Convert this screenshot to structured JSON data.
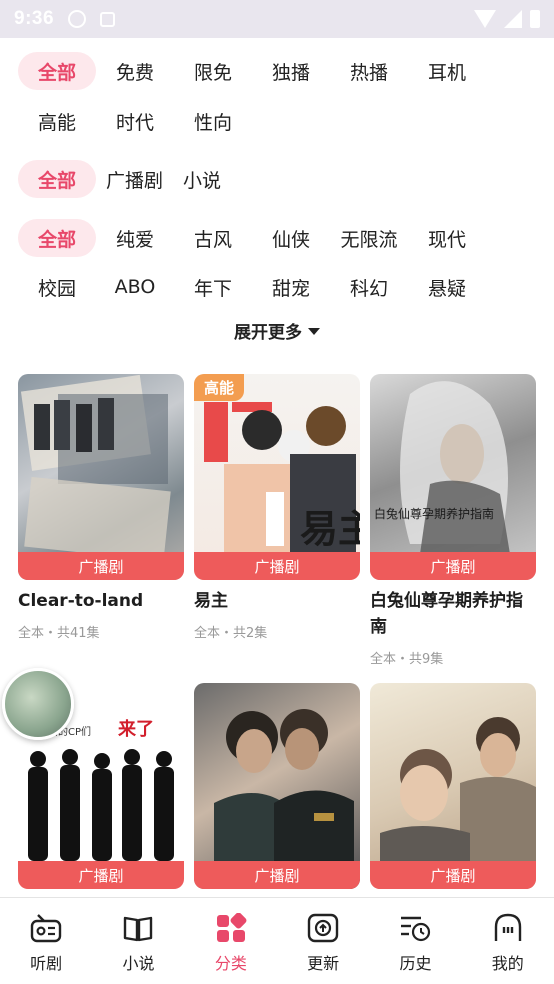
{
  "status_bar": {
    "time": "9:36"
  },
  "filters": {
    "row1": [
      "全部",
      "免费",
      "限免",
      "独播",
      "热播",
      "耳机"
    ],
    "row2": [
      "高能",
      "时代",
      "性向"
    ],
    "row3": [
      "全部",
      "广播剧",
      "小说"
    ],
    "row4": [
      "全部",
      "纯爱",
      "古风",
      "仙侠",
      "无限流",
      "现代"
    ],
    "row5": [
      "校园",
      "ABO",
      "年下",
      "甜宠",
      "科幻",
      "悬疑"
    ],
    "expand_label": "展开更多"
  },
  "cards": [
    {
      "title": "Clear-to-land",
      "tag": "广播剧",
      "meta": "全本・共41集",
      "badge": ""
    },
    {
      "title": "易主",
      "tag": "广播剧",
      "meta": "全本・共2集",
      "badge": "高能"
    },
    {
      "title": "白兔仙尊孕期养护指南",
      "tag": "广播剧",
      "meta": "全本・共9集",
      "badge": ""
    },
    {
      "title": "",
      "tag": "广播剧",
      "meta": "",
      "badge": ""
    },
    {
      "title": "",
      "tag": "广播剧",
      "meta": "",
      "badge": ""
    },
    {
      "title": "",
      "tag": "广播剧",
      "meta": "",
      "badge": ""
    }
  ],
  "cover_texts": {
    "card2_side": "广播剧",
    "card2_big": "易主",
    "card3_title": "白兔仙尊孕期养护指南",
    "card4_top": "主播的CP们",
    "card4_red": "来了"
  },
  "bottom_nav": [
    {
      "label": "听剧",
      "icon": "radio-icon"
    },
    {
      "label": "小说",
      "icon": "book-icon"
    },
    {
      "label": "分类",
      "icon": "category-icon"
    },
    {
      "label": "更新",
      "icon": "update-icon"
    },
    {
      "label": "历史",
      "icon": "history-icon"
    },
    {
      "label": "我的",
      "icon": "profile-ghost-icon"
    }
  ],
  "colors": {
    "accent": "#e8486a",
    "chip_bg": "#fde8ec",
    "tag_red": "#ee5b5b",
    "badge_orange": "#f39d50"
  }
}
